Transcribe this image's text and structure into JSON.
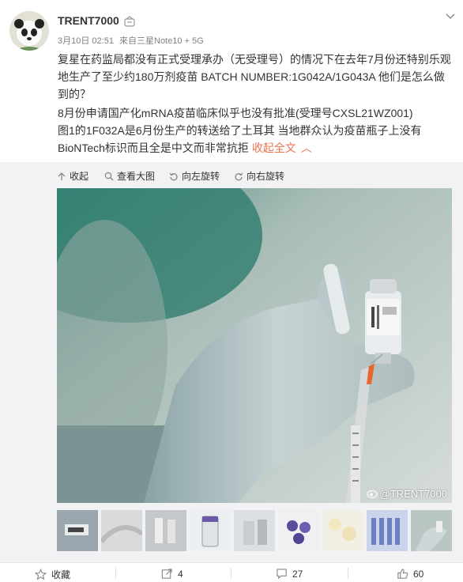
{
  "post": {
    "username": "TRENT7000",
    "timestamp": "3月10日 02:51",
    "source": "來自三星Note10 + 5G",
    "paragraphs": [
      "复星在药监局都没有正式受理承办（无受理号）的情况下在去年7月份还特别乐观地生产了至少约180万剂疫苗 BATCH NUMBER:1G042A/1G043A 他们是怎么做到的？",
      "8月份申请国产化mRNA疫苗临床似乎也没有批准(受理号CXSL21WZ001)",
      "图1的1F032A是6月份生产的转送给了土耳其 当地群众认为疫苗瓶子上没有BioNTech标识而且全是中文而非常抗拒"
    ],
    "collapse_label": "收起全文",
    "collapse_chevron": "︿"
  },
  "toolbar": {
    "collapse": "收起",
    "view_large": "查看大图",
    "rotate_left": "向左旋转",
    "rotate_right": "向右旋转"
  },
  "media": {
    "watermark": "@TRENT7000",
    "thumbnail_count": 9,
    "active_thumbnail": 9
  },
  "footer": {
    "favorite": "收藏",
    "forward_count": "4",
    "comment_count": "27",
    "like_count": "60"
  },
  "colors": {
    "accent": "#eb7350",
    "active_border": "#ff8a00",
    "media_bg": "#f2f2f5"
  },
  "icons": [
    "panda-avatar",
    "verified-badge-icon",
    "chevron-down-icon",
    "arrow-up-icon",
    "magnifier-icon",
    "rotate-left-icon",
    "rotate-right-icon",
    "weibo-eye-icon",
    "star-icon",
    "share-icon",
    "comment-icon",
    "thumbs-up-icon"
  ]
}
